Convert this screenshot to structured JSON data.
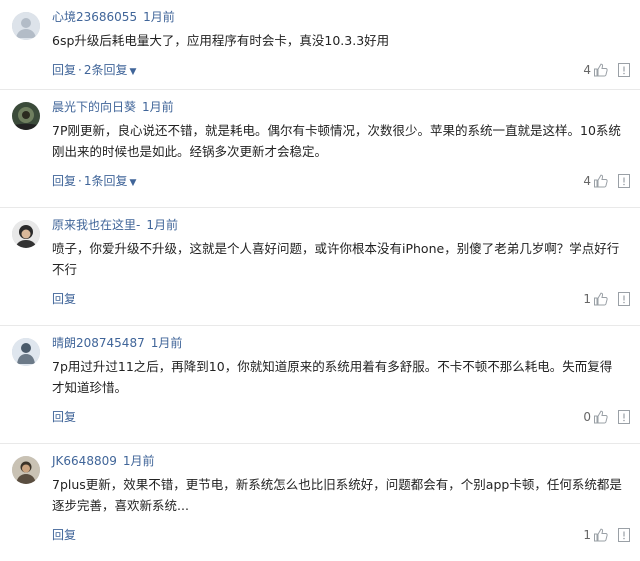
{
  "comments": [
    {
      "username": "心境23686055",
      "time": "1月前",
      "text": "6sp升级后耗电量大了，应用程序有时会卡，真没10.3.3好用",
      "reply_label": "回复",
      "replies_label": "2条回复",
      "likes": "4",
      "avatar": "default-avatar"
    },
    {
      "username": "晨光下的向日葵",
      "time": "1月前",
      "text": "7P刚更新，良心说还不错，就是耗电。偶尔有卡顿情况，次数很少。苹果的系统一直就是这样。10系统刚出来的时候也是如此。经锅多次更新才会稳定。",
      "reply_label": "回复",
      "replies_label": "1条回复",
      "likes": "4",
      "avatar": "photo-avatar"
    },
    {
      "username": "原来我也在这里-",
      "time": "1月前",
      "text": "喷子，你爱升级不升级，这就是个人喜好问题，或许你根本没有iPhone，别傻了老弟几岁啊？学点好行不行",
      "reply_label": "回复",
      "likes": "1",
      "avatar": "photo-avatar"
    },
    {
      "username": "晴朗208745487",
      "time": "1月前",
      "text": "7p用过升过11之后，再降到10，你就知道原来的系统用着有多舒服。不卡不顿不那么耗电。失而复得才知道珍惜。",
      "reply_label": "回复",
      "likes": "0",
      "avatar": "photo-avatar"
    },
    {
      "username": "JK6648809",
      "time": "1月前",
      "text": "7plus更新，效果不错，更节电，新系统怎么也比旧系统好，问题都会有，个别app卡顿，任何系统都是逐步完善，喜欢新系统...",
      "reply_label": "回复",
      "likes": "1",
      "avatar": "photo-avatar"
    }
  ]
}
